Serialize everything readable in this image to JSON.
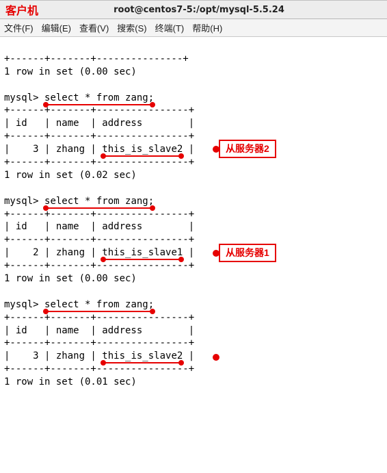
{
  "titlebar": {
    "label": "客户机",
    "center": "root@centos7-5:/opt/mysql-5.5.24"
  },
  "menubar": {
    "file": "文件(F)",
    "edit": "编辑(E)",
    "view": "查看(V)",
    "search": "搜索(S)",
    "term": "终端(T)",
    "help": "帮助(H)"
  },
  "block0": {
    "sep": "+------+-------+---------------+",
    "result": "1 row in set (0.00 sec)"
  },
  "query_prefix": "mysql> ",
  "query_text": "select * from zang;",
  "query1": {
    "sep": "+------+-------+----------------+",
    "head": "| id   | name  | address        |",
    "row": "|    3 | zhang | ",
    "rowval": "this_is_slave2",
    "rowend": " |",
    "result": "1 row in set (0.02 sec)"
  },
  "query2": {
    "sep": "+------+-------+----------------+",
    "head": "| id   | name  | address        |",
    "row": "|    2 | zhang | ",
    "rowval": "this_is_slave1",
    "rowend": " |",
    "result": "1 row in set (0.00 sec)"
  },
  "query3": {
    "sep": "+------+-------+----------------+",
    "head": "| id   | name  | address        |",
    "row": "|    3 | zhang | ",
    "rowval": "this_is_slave2",
    "rowend": " |",
    "result": "1 row in set (0.01 sec)"
  },
  "callouts": {
    "slave2": "从服务器2",
    "slave1": "从服务器1"
  }
}
